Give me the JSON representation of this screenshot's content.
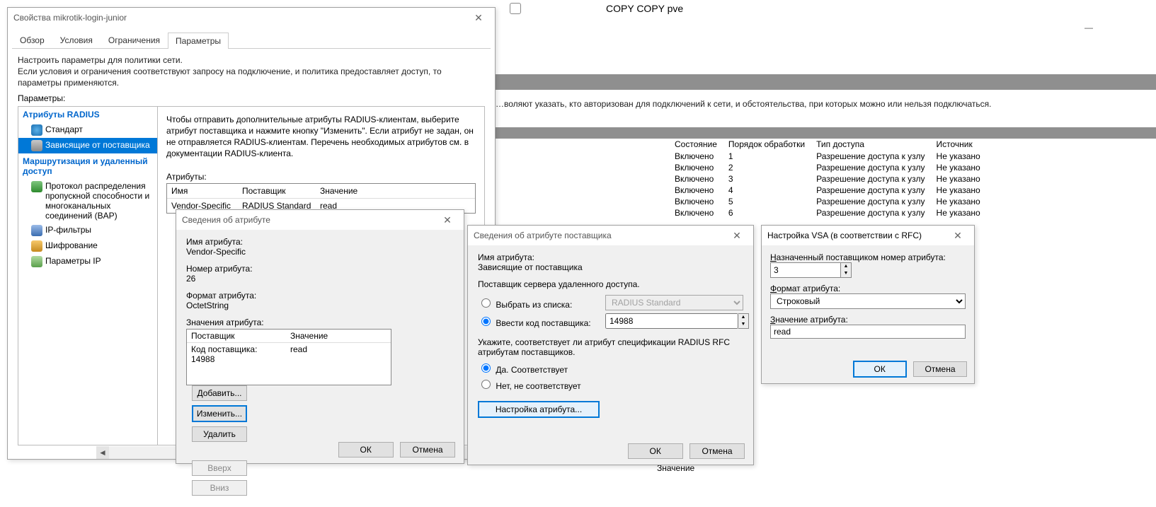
{
  "bg": {
    "appTitle": "COPY COPY pve",
    "desc": "…воляют указать, кто авторизован для подключений к сети, и обстоятельства, при которых можно или нельзя подключаться.",
    "valueLabel": "Значение",
    "columns": [
      "Состояние",
      "Порядок обработки",
      "Тип доступа",
      "Источник"
    ],
    "rows": [
      {
        "state": "Включено",
        "order": "1",
        "access": "Разрешение доступа к узлу",
        "src": "Не указано"
      },
      {
        "state": "Включено",
        "order": "2",
        "access": "Разрешение доступа к узлу",
        "src": "Не указано"
      },
      {
        "state": "Включено",
        "order": "3",
        "access": "Разрешение доступа к узлу",
        "src": "Не указано"
      },
      {
        "state": "Включено",
        "order": "4",
        "access": "Разрешение доступа к узлу",
        "src": "Не указано"
      },
      {
        "state": "Включено",
        "order": "5",
        "access": "Разрешение доступа к узлу",
        "src": "Не указано"
      },
      {
        "state": "Включено",
        "order": "6",
        "access": "Разрешение доступа к узлу",
        "src": "Не указано"
      }
    ]
  },
  "props": {
    "title": "Свойства mikrotik-login-junior",
    "tabs": [
      "Обзор",
      "Условия",
      "Ограничения",
      "Параметры"
    ],
    "activeTab": 3,
    "desc1": "Настроить параметры для политики сети.",
    "desc2": "Если условия и ограничения соответствуют запросу на подключение, и политика предоставляет доступ, то параметры применяются.",
    "paramsLabel": "Параметры:",
    "cats": {
      "radius": "Атрибуты RADIUS",
      "routing": "Маршрутизация и удаленный доступ"
    },
    "items": {
      "standard": "Стандарт",
      "vendor": "Зависящие от поставщика",
      "bap": "Протокол распределения пропускной способности и многоканальных соединений (BAP)",
      "ipfilters": "IP-фильтры",
      "encryption": "Шифрование",
      "ipparams": "Параметры IP"
    },
    "intro": "Чтобы отправить дополнительные атрибуты RADIUS-клиентам, выберите атрибут поставщика и нажмите кнопку \"Изменить\". Если атрибут не задан, он не отправляется RADIUS-клиентам. Перечень необходимых атрибутов см. в документации RADIUS-клиента.",
    "attrsLabel": "Атрибуты:",
    "attrCols": {
      "name": "Имя",
      "vendor": "Поставщик",
      "value": "Значение"
    },
    "attrRow": {
      "name": "Vendor-Specific",
      "vendor": "RADIUS Standard",
      "value": "read"
    }
  },
  "dlgAttr": {
    "title": "Сведения об атрибуте",
    "nameLabel": "Имя атрибута:",
    "nameValue": "Vendor-Specific",
    "numLabel": "Номер атрибута:",
    "numValue": "26",
    "fmtLabel": "Формат атрибута:",
    "fmtValue": "OctetString",
    "valsLabel": "Значения атрибута:",
    "cols": {
      "vendor": "Поставщик",
      "value": "Значение"
    },
    "row": {
      "vendor": "Код поставщика: 14988",
      "value": "read"
    },
    "btns": {
      "add": "Добавить...",
      "edit": "Изменить...",
      "del": "Удалить",
      "up": "Вверх",
      "down": "Вниз",
      "ok": "ОК",
      "cancel": "Отмена"
    }
  },
  "dlgVendor": {
    "title": "Сведения об атрибуте поставщика",
    "nameLabel": "Имя атрибута:",
    "nameValue": "Зависящие от поставщика",
    "serverLabel": "Поставщик сервера удаленного доступа.",
    "radioList": "Выбрать из списка:",
    "listValue": "RADIUS Standard",
    "radioCode": "Ввести код поставщика:",
    "codeValue": "14988",
    "rfcLabel": "Укажите, соответствует ли атрибут спецификации RADIUS RFC атрибутам поставщиков.",
    "radioYes": "Да. Соответствует",
    "radioNo": "Нет, не соответствует",
    "cfgBtn": "Настройка атрибута...",
    "ok": "ОК",
    "cancel": "Отмена"
  },
  "dlgVsa": {
    "title": "Настройка VSA (в соответствии с RFC)",
    "numLabel": "Назначенный поставщиком номер атрибута:",
    "numValue": "3",
    "fmtLabel": "Формат атрибута:",
    "fmtValue": "Строковый",
    "valLabel": "Значение атрибута:",
    "valValue": "read",
    "ok": "ОК",
    "cancel": "Отмена"
  }
}
